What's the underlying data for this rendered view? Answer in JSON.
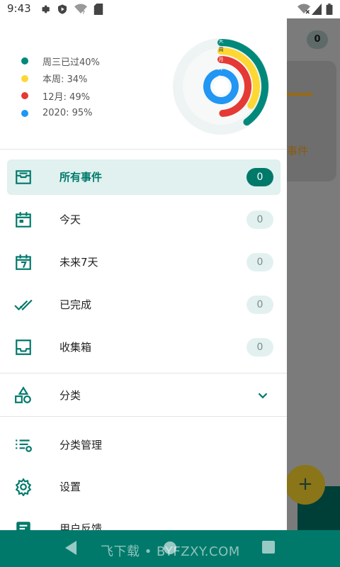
{
  "status": {
    "time": "9:43"
  },
  "legend": [
    {
      "label": "周三已过40%",
      "color": "#00897b",
      "percent": 40
    },
    {
      "label": "本周: 34%",
      "color": "#fdd835",
      "percent": 34
    },
    {
      "label": "12月: 49%",
      "color": "#e53935",
      "percent": 49
    },
    {
      "label": "2020: 95%",
      "color": "#2196f3",
      "percent": 95
    }
  ],
  "rings": {
    "day": "天",
    "week": "周",
    "month": "月",
    "year": "年"
  },
  "nav": [
    {
      "label": "所有事件",
      "count": "0",
      "icon": "inbox-tray-icon",
      "active": true
    },
    {
      "label": "今天",
      "count": "0",
      "icon": "calendar-today-icon",
      "active": false
    },
    {
      "label": "未来7天",
      "count": "0",
      "icon": "calendar-7-icon",
      "active": false
    },
    {
      "label": "已完成",
      "count": "0",
      "icon": "double-check-icon",
      "active": false
    },
    {
      "label": "收集箱",
      "count": "0",
      "icon": "inbox-icon",
      "active": false
    }
  ],
  "category": {
    "label": "分类",
    "icon": "shapes-icon",
    "expand_icon": "chevron-down-icon"
  },
  "tools": [
    {
      "label": "分类管理",
      "icon": "list-settings-icon"
    },
    {
      "label": "设置",
      "icon": "gear-icon"
    },
    {
      "label": "用户反馈",
      "icon": "feedback-icon"
    }
  ],
  "background_app": {
    "badge": "0",
    "partial_text": "事件",
    "fab": "+"
  },
  "watermark": "飞下载 • BYFZXY.COM",
  "colors": {
    "accent": "#00796b",
    "active_bg": "#e0f1ef",
    "badge_bg": "#e2f1ef"
  }
}
